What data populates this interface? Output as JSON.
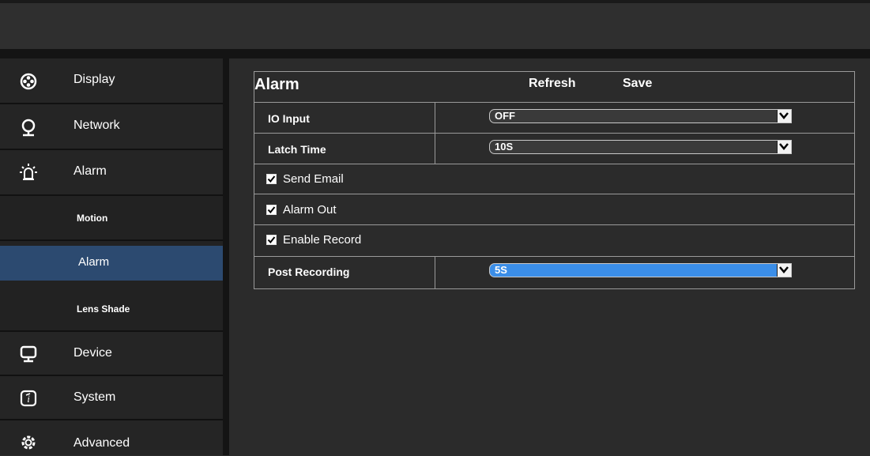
{
  "sidebar": {
    "items": [
      {
        "label": "Display",
        "icon": "display-icon"
      },
      {
        "label": "Network",
        "icon": "network-icon"
      },
      {
        "label": "Alarm",
        "icon": "alarm-icon"
      },
      {
        "label": "Device",
        "icon": "device-icon"
      },
      {
        "label": "System",
        "icon": "system-icon"
      },
      {
        "label": "Advanced",
        "icon": "advanced-icon"
      }
    ],
    "alarm_sub": [
      {
        "label": "Motion"
      },
      {
        "label": "Alarm"
      },
      {
        "label": "Lens Shade"
      }
    ]
  },
  "panel": {
    "title": "Alarm",
    "refresh": "Refresh",
    "save": "Save",
    "io_input": {
      "label": "IO Input",
      "value": "OFF"
    },
    "latch_time": {
      "label": "Latch Time",
      "value": "10S"
    },
    "send_email": {
      "label": "Send Email",
      "checked": true
    },
    "alarm_out": {
      "label": "Alarm Out",
      "checked": true
    },
    "enable_record": {
      "label": "Enable Record",
      "checked": true
    },
    "post_recording": {
      "label": "Post Recording",
      "value": "5S"
    }
  },
  "colors": {
    "active_sub": "#2c4a70",
    "select_highlight": "#3b8ee8"
  }
}
